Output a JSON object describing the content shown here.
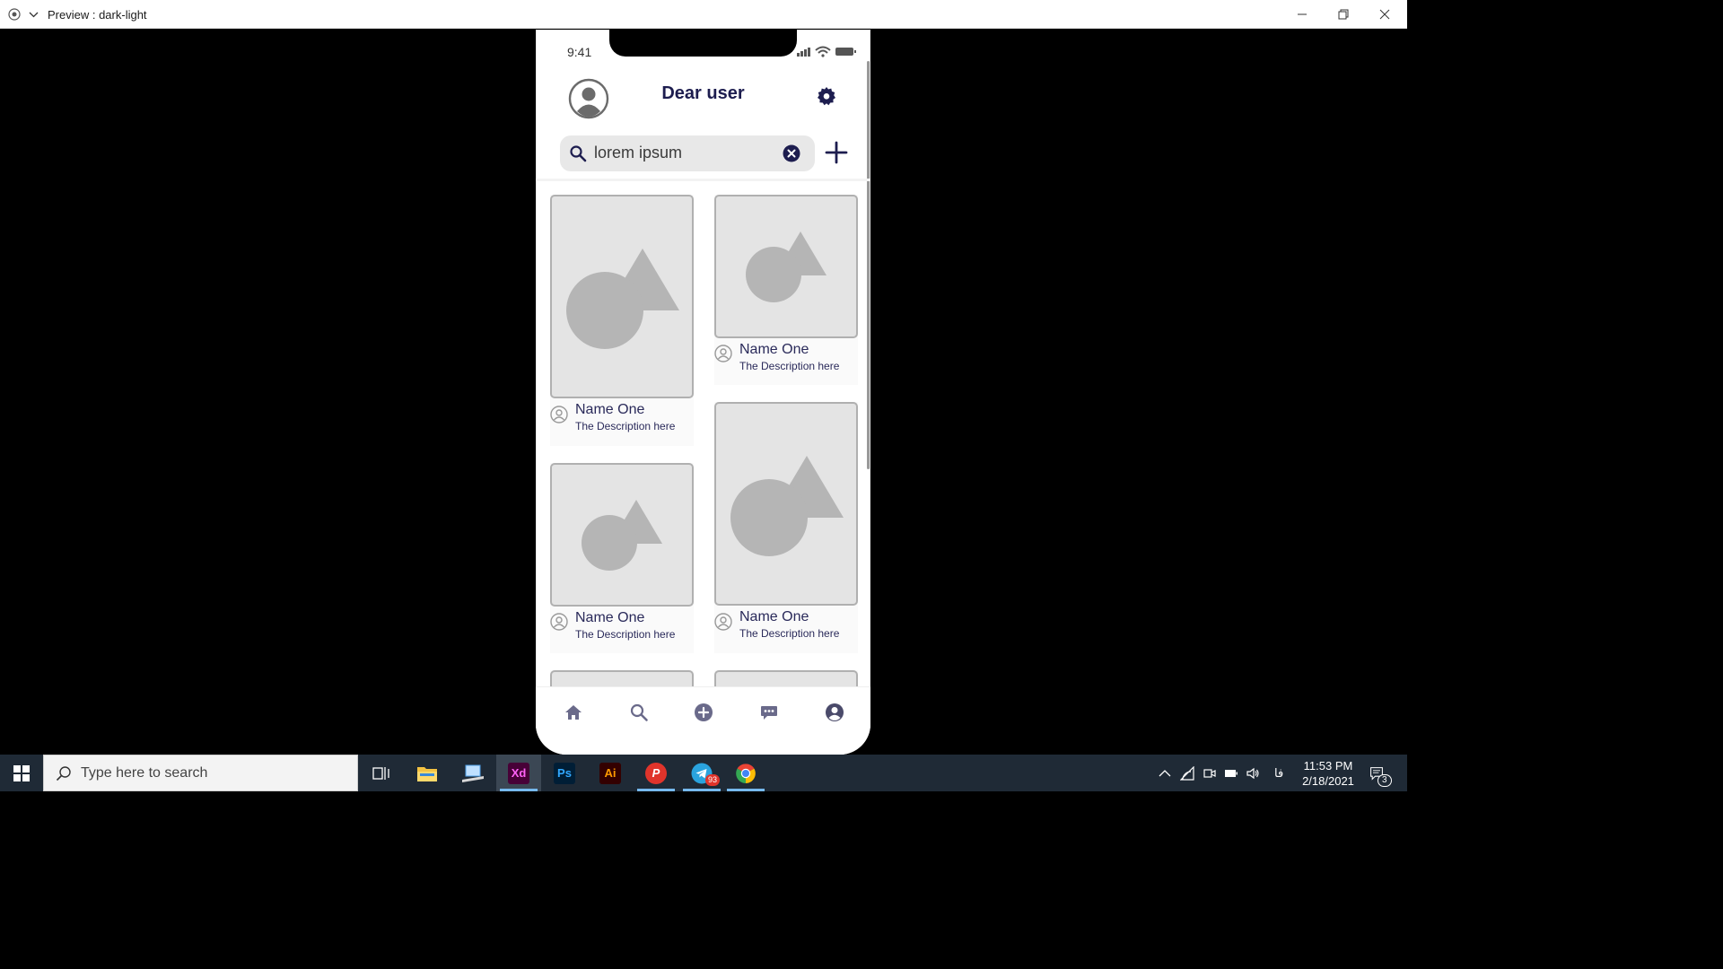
{
  "window": {
    "title": "Preview : dark-light"
  },
  "phone": {
    "status_time": "9:41",
    "header": {
      "title": "Dear user"
    },
    "search": {
      "value": "lorem ipsum"
    },
    "cards": [
      {
        "name": "Name One",
        "description": "The Description here"
      },
      {
        "name": "Name One",
        "description": "The Description here"
      },
      {
        "name": "Name One",
        "description": "The Description here"
      },
      {
        "name": "Name One",
        "description": "The Description here"
      }
    ],
    "tabs": [
      "home-icon",
      "search-icon",
      "add-circle-icon",
      "chat-icon",
      "profile-icon"
    ],
    "colors": {
      "accent": "#1d1d4f",
      "placeholder": "#b5b5b5",
      "card_bg": "#e4e4e4"
    }
  },
  "taskbar": {
    "search_placeholder": "Type here to search",
    "apps": [
      "task-view-icon",
      "file-explorer-icon",
      "app-icon",
      "Xd",
      "Ps",
      "Ai",
      "P",
      "telegram-icon",
      "chrome-icon"
    ],
    "telegram_badge": "93",
    "ime_indicator": "فا",
    "clock_time": "11:53 PM",
    "clock_date": "2/18/2021",
    "notification_count": "3"
  }
}
